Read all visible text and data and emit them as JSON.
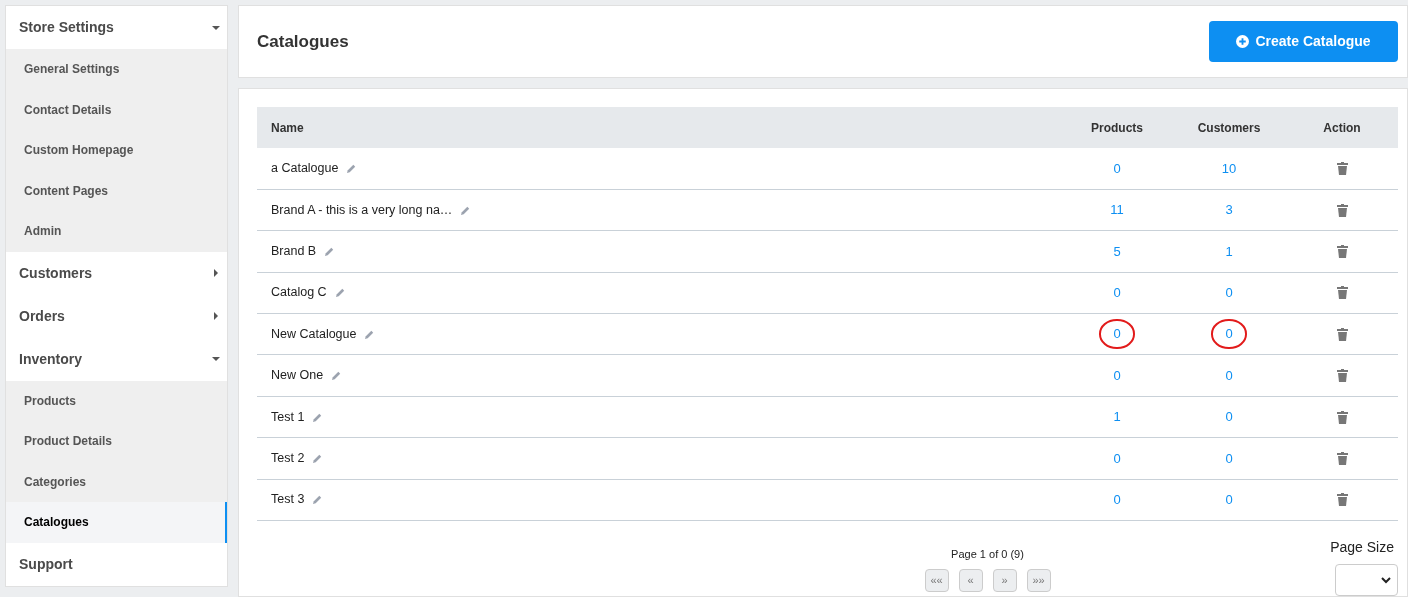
{
  "sidebar": {
    "sections": [
      {
        "label": "Store Settings",
        "expanded": true,
        "expandable": true,
        "children": [
          {
            "label": "General Settings",
            "selected": false
          },
          {
            "label": "Contact Details",
            "selected": false
          },
          {
            "label": "Custom Homepage",
            "selected": false
          },
          {
            "label": "Content Pages",
            "selected": false
          },
          {
            "label": "Admin",
            "selected": false
          }
        ]
      },
      {
        "label": "Customers",
        "expanded": false,
        "expandable": true
      },
      {
        "label": "Orders",
        "expanded": false,
        "expandable": true
      },
      {
        "label": "Inventory",
        "expanded": true,
        "expandable": true,
        "children": [
          {
            "label": "Products",
            "selected": false
          },
          {
            "label": "Product Details",
            "selected": false
          },
          {
            "label": "Categories",
            "selected": false
          },
          {
            "label": "Catalogues",
            "selected": true
          }
        ]
      },
      {
        "label": "Support",
        "expanded": false,
        "expandable": false
      }
    ]
  },
  "header": {
    "title": "Catalogues",
    "create_button": "Create Catalogue"
  },
  "table": {
    "columns": [
      "Name",
      "Products",
      "Customers",
      "Action"
    ],
    "rows": [
      {
        "name": "a Catalogue",
        "products": {
          "value": "0",
          "circled": false
        },
        "customers": {
          "value": "10",
          "circled": false
        }
      },
      {
        "name": "Brand A - this is a very long na…",
        "products": {
          "value": "11",
          "circled": false
        },
        "customers": {
          "value": "3",
          "circled": false
        }
      },
      {
        "name": "Brand B",
        "products": {
          "value": "5",
          "circled": false
        },
        "customers": {
          "value": "1",
          "circled": false
        }
      },
      {
        "name": "Catalog C",
        "products": {
          "value": "0",
          "circled": false
        },
        "customers": {
          "value": "0",
          "circled": false
        }
      },
      {
        "name": "New Catalogue",
        "products": {
          "value": "0",
          "circled": true
        },
        "customers": {
          "value": "0",
          "circled": true
        }
      },
      {
        "name": "New One",
        "products": {
          "value": "0",
          "circled": false
        },
        "customers": {
          "value": "0",
          "circled": false
        }
      },
      {
        "name": "Test 1",
        "products": {
          "value": "1",
          "circled": false
        },
        "customers": {
          "value": "0",
          "circled": false
        }
      },
      {
        "name": "Test 2",
        "products": {
          "value": "0",
          "circled": false
        },
        "customers": {
          "value": "0",
          "circled": false
        }
      },
      {
        "name": "Test 3",
        "products": {
          "value": "0",
          "circled": false
        },
        "customers": {
          "value": "0",
          "circled": false
        }
      }
    ]
  },
  "pagination": {
    "summary": "Page 1 of 0 (9)",
    "buttons": [
      "««",
      "«",
      "»",
      "»»"
    ],
    "page_size_label": "Page Size"
  }
}
